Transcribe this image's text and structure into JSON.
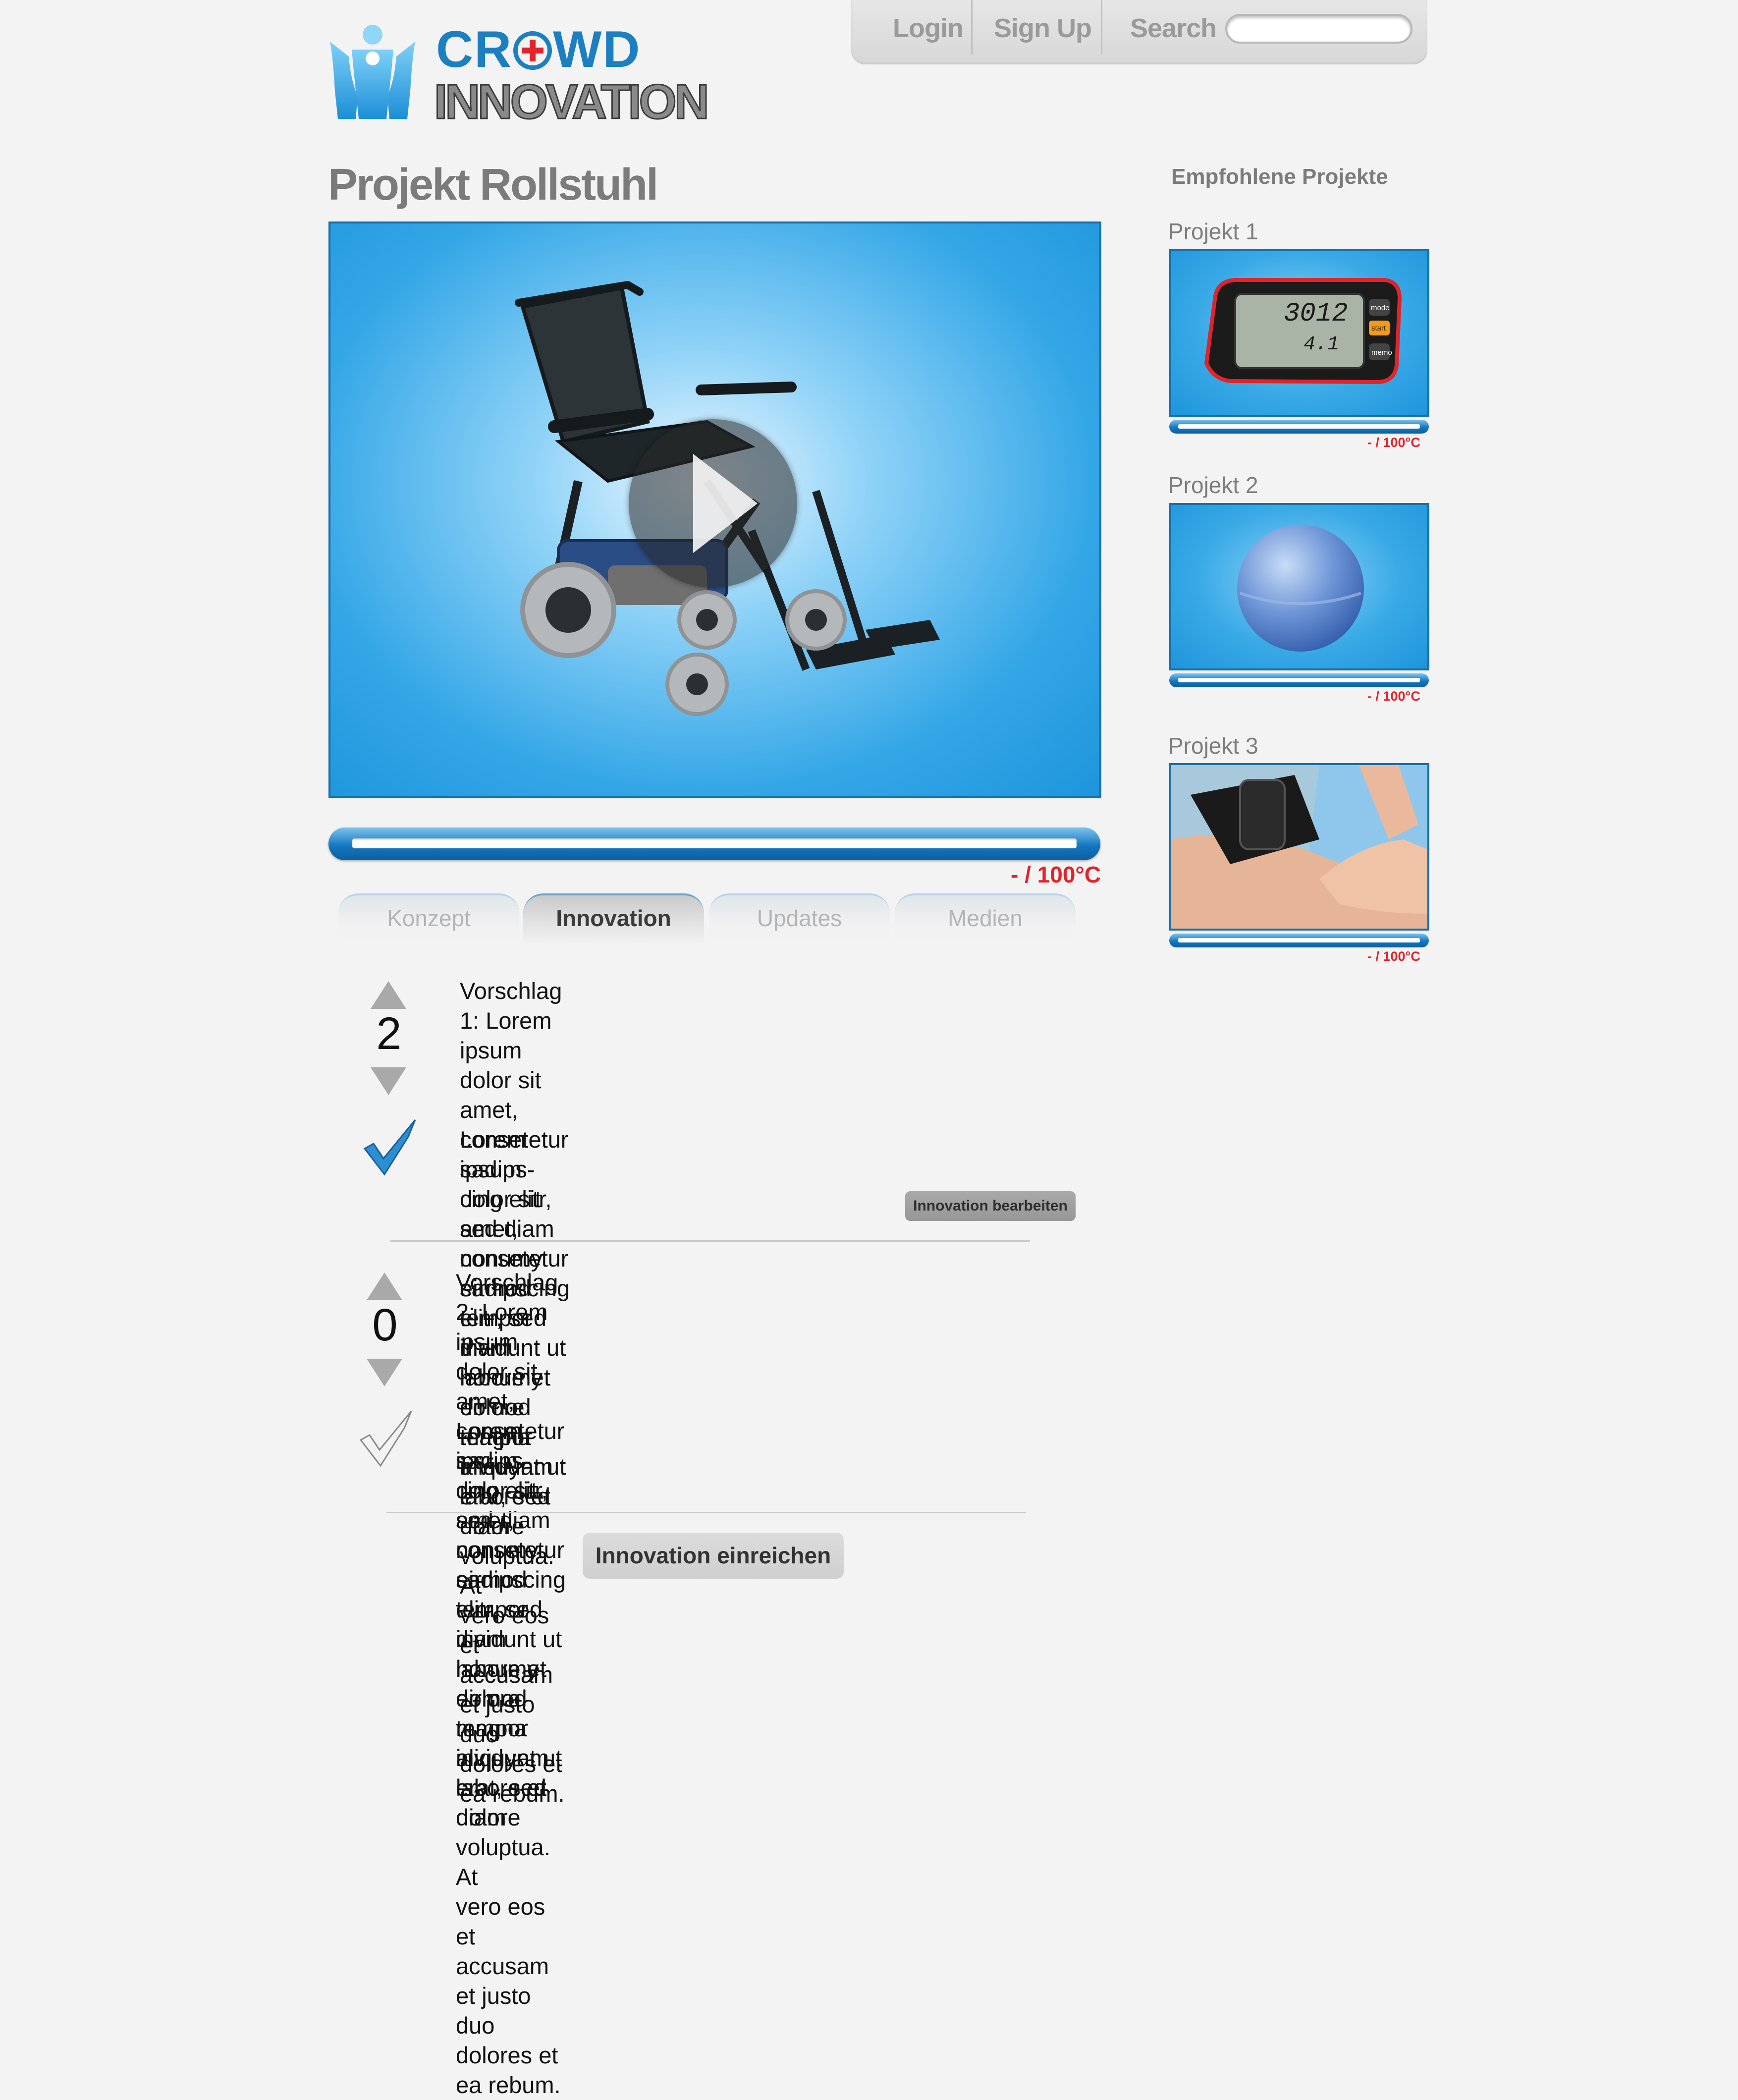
{
  "brand": {
    "line1": "CR",
    "line1b": "WD",
    "line2": "INNOVATION"
  },
  "nav": {
    "login": "Login",
    "signup": "Sign Up",
    "search_label": "Search",
    "search_value": "",
    "search_placeholder": ""
  },
  "project": {
    "title": "Projekt Rollstuhl",
    "progress_fraction": 1.0,
    "degree_label": "- /  100°C"
  },
  "tabs": [
    {
      "label": "Konzept",
      "active": false
    },
    {
      "label": "Innovation",
      "active": true
    },
    {
      "label": "Updates",
      "active": false
    },
    {
      "label": "Medien",
      "active": false
    }
  ],
  "proposals": [
    {
      "votes": "2",
      "text_lines": [
        "Vorschlag 1: Lorem ipsum dolor sit amet, consetetur sadips-",
        "cing elitr, sed diam nonumy eirmod tempor invidunt ut",
        "labore et dolore magna aliquyam erat, sed diam voluptua. At",
        "vero eos et accusam et justo duo dolores et ea rebum."
      ],
      "accepted": true,
      "note_lines": [
        "Lorem ipsum dolor sit amet, consetetur sadipscing elitr, sed",
        "diam nonumy eirmod tempor invidunt ut labore et dolore"
      ],
      "edit_button": "Innovation bearbeiten"
    },
    {
      "votes": "0",
      "text_lines": [
        "Vorschlag 2: Lorem ipsum dolor sit amet, consetetur sadips-",
        "cing elitr, sed diam nonumy eirmod tempor invidunt ut",
        "labore et dolore magna aliquyam erat, sed diam voluptua. At",
        "vero eos et accusam et justo duo dolores et ea rebum."
      ],
      "accepted": false,
      "note_lines": [
        "Lorem ipsum dolor sit amet, consetetur sadipscing elitr, sed",
        "diam nonumy eirmod tempor invidunt ut labore et dolore"
      ]
    }
  ],
  "submit_button": "Innovation einreichen",
  "sidebar": {
    "heading": "Empfohlene Projekte",
    "projects": [
      {
        "label": "Projekt 1",
        "degree_label": "- /  100°C",
        "progress_fraction": 1.0,
        "pedometer_steps": "3012",
        "pedometer_km": "4.1",
        "pedometer_btn1": "mode",
        "pedometer_btn2": "start",
        "pedometer_btn3": "memo"
      },
      {
        "label": "Projekt 2",
        "degree_label": "- /  100°C",
        "progress_fraction": 1.0
      },
      {
        "label": "Projekt 3",
        "degree_label": "- /  100°C",
        "progress_fraction": 1.0
      }
    ]
  },
  "colors": {
    "accent_blue": "#1e95dc",
    "degree_red": "#e0242c",
    "text_gray": "#7b7b7b"
  }
}
